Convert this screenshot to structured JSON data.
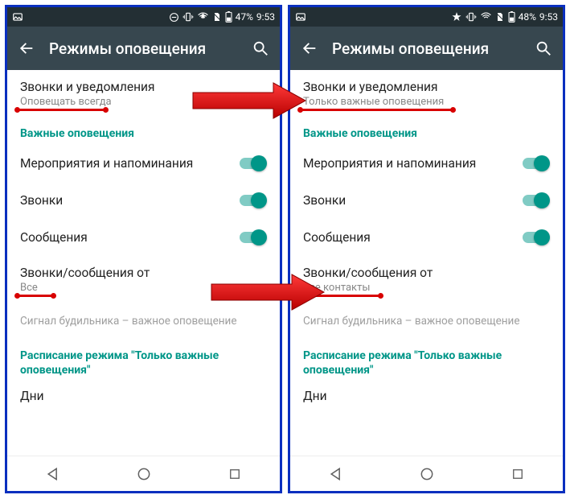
{
  "left": {
    "status": {
      "battery": "47%",
      "time": "9:53"
    },
    "appbar": {
      "title": "Режимы оповещения"
    },
    "item1": {
      "title": "Звонки и уведомления",
      "sub": "Оповещать всегда"
    },
    "section1": "Важные оповещения",
    "rows": {
      "events": "Мероприятия и напоминания",
      "calls": "Звонки",
      "messages": "Сообщения"
    },
    "item2": {
      "title": "Звонки/сообщения от",
      "sub": "Все"
    },
    "hint": "Сигнал будильника – важное оповещение",
    "section2": "Расписание режима \"Только важные оповещения\"",
    "days": "Дни"
  },
  "right": {
    "status": {
      "battery": "48%",
      "time": "9:53"
    },
    "appbar": {
      "title": "Режимы оповещения"
    },
    "item1": {
      "title": "Звонки и уведомления",
      "sub": "Только важные оповещения"
    },
    "section1": "Важные оповещения",
    "rows": {
      "events": "Мероприятия и напоминания",
      "calls": "Звонки",
      "messages": "Сообщения"
    },
    "item2": {
      "title": "Звонки/сообщения от",
      "sub": "Все контакты"
    },
    "hint": "Сигнал будильника – важное оповещение",
    "section2": "Расписание режима \"Только важные оповещения\"",
    "days": "Дни"
  }
}
